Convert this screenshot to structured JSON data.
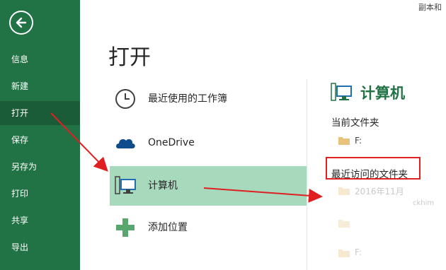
{
  "window": {
    "title_fragment": "副本和"
  },
  "sidebar": {
    "items": [
      {
        "label": "信息"
      },
      {
        "label": "新建"
      },
      {
        "label": "打开"
      },
      {
        "label": "保存"
      },
      {
        "label": "另存为"
      },
      {
        "label": "打印"
      },
      {
        "label": "共享"
      },
      {
        "label": "导出"
      }
    ],
    "active_index": 2
  },
  "main": {
    "title": "打开",
    "places": [
      {
        "label": "最近使用的工作簿",
        "icon": "clock-icon"
      },
      {
        "label": "OneDrive",
        "icon": "cloud-icon"
      },
      {
        "label": "计算机",
        "icon": "computer-icon",
        "selected": true
      },
      {
        "label": "添加位置",
        "icon": "plus-icon"
      }
    ]
  },
  "right_panel": {
    "title": "计算机",
    "current_folder_label": "当前文件夹",
    "current_folder": "F:",
    "recent_folders_label": "最近访问的文件夹",
    "recent_folders": [
      "2016年11月",
      "",
      "F:"
    ],
    "faint_text": "ckhim"
  },
  "colors": {
    "sidebar_bg": "#217346",
    "sidebar_active": "#1a5c38",
    "selected_bg": "#a7d9bd",
    "accent_green": "#217346",
    "annotation_red": "#e02020"
  }
}
